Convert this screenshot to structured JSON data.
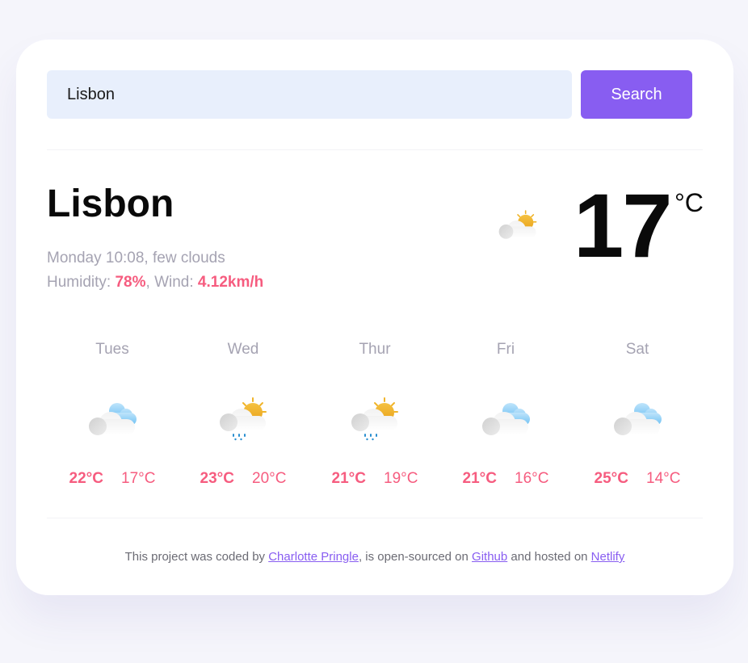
{
  "search": {
    "value": "Lisbon",
    "button_label": "Search"
  },
  "current": {
    "city": "Lisbon",
    "datetime": "Monday 10:08",
    "description": "few clouds",
    "humidity_label": "Humidity:",
    "humidity_value": "78%",
    "wind_label": "Wind:",
    "wind_value": "4.12km/h",
    "temperature": "17",
    "unit": "°C",
    "icon": "few-clouds-icon"
  },
  "forecast": [
    {
      "day": "Tues",
      "icon": "scattered-clouds-icon",
      "max": "22°C",
      "min": "17°C"
    },
    {
      "day": "Wed",
      "icon": "rain-sun-icon",
      "max": "23°C",
      "min": "20°C"
    },
    {
      "day": "Thur",
      "icon": "rain-sun-icon",
      "max": "21°C",
      "min": "19°C"
    },
    {
      "day": "Fri",
      "icon": "scattered-clouds-icon",
      "max": "21°C",
      "min": "16°C"
    },
    {
      "day": "Sat",
      "icon": "scattered-clouds-icon",
      "max": "25°C",
      "min": "14°C"
    }
  ],
  "footer": {
    "prefix": "This project was coded by ",
    "author_link": "Charlotte Pringle",
    "middle": ", is open-sourced on ",
    "github_link": "Github",
    "and_text": " and hosted on ",
    "netlify_link": "Netlify"
  },
  "colors": {
    "accent": "#885df1",
    "highlight": "#f65c7f",
    "muted": "#a5a3b2",
    "input_bg": "#e8effc"
  }
}
